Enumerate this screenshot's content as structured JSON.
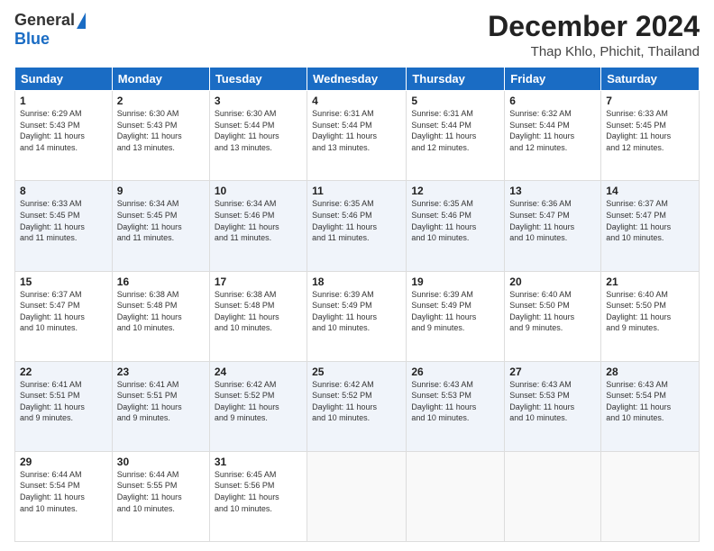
{
  "logo": {
    "general": "General",
    "blue": "Blue"
  },
  "title": {
    "month": "December 2024",
    "location": "Thap Khlo, Phichit, Thailand"
  },
  "weekdays": [
    "Sunday",
    "Monday",
    "Tuesday",
    "Wednesday",
    "Thursday",
    "Friday",
    "Saturday"
  ],
  "weeks": [
    [
      {
        "day": "1",
        "text": "Sunrise: 6:29 AM\nSunset: 5:43 PM\nDaylight: 11 hours\nand 14 minutes."
      },
      {
        "day": "2",
        "text": "Sunrise: 6:30 AM\nSunset: 5:43 PM\nDaylight: 11 hours\nand 13 minutes."
      },
      {
        "day": "3",
        "text": "Sunrise: 6:30 AM\nSunset: 5:44 PM\nDaylight: 11 hours\nand 13 minutes."
      },
      {
        "day": "4",
        "text": "Sunrise: 6:31 AM\nSunset: 5:44 PM\nDaylight: 11 hours\nand 13 minutes."
      },
      {
        "day": "5",
        "text": "Sunrise: 6:31 AM\nSunset: 5:44 PM\nDaylight: 11 hours\nand 12 minutes."
      },
      {
        "day": "6",
        "text": "Sunrise: 6:32 AM\nSunset: 5:44 PM\nDaylight: 11 hours\nand 12 minutes."
      },
      {
        "day": "7",
        "text": "Sunrise: 6:33 AM\nSunset: 5:45 PM\nDaylight: 11 hours\nand 12 minutes."
      }
    ],
    [
      {
        "day": "8",
        "text": "Sunrise: 6:33 AM\nSunset: 5:45 PM\nDaylight: 11 hours\nand 11 minutes."
      },
      {
        "day": "9",
        "text": "Sunrise: 6:34 AM\nSunset: 5:45 PM\nDaylight: 11 hours\nand 11 minutes."
      },
      {
        "day": "10",
        "text": "Sunrise: 6:34 AM\nSunset: 5:46 PM\nDaylight: 11 hours\nand 11 minutes."
      },
      {
        "day": "11",
        "text": "Sunrise: 6:35 AM\nSunset: 5:46 PM\nDaylight: 11 hours\nand 11 minutes."
      },
      {
        "day": "12",
        "text": "Sunrise: 6:35 AM\nSunset: 5:46 PM\nDaylight: 11 hours\nand 10 minutes."
      },
      {
        "day": "13",
        "text": "Sunrise: 6:36 AM\nSunset: 5:47 PM\nDaylight: 11 hours\nand 10 minutes."
      },
      {
        "day": "14",
        "text": "Sunrise: 6:37 AM\nSunset: 5:47 PM\nDaylight: 11 hours\nand 10 minutes."
      }
    ],
    [
      {
        "day": "15",
        "text": "Sunrise: 6:37 AM\nSunset: 5:47 PM\nDaylight: 11 hours\nand 10 minutes."
      },
      {
        "day": "16",
        "text": "Sunrise: 6:38 AM\nSunset: 5:48 PM\nDaylight: 11 hours\nand 10 minutes."
      },
      {
        "day": "17",
        "text": "Sunrise: 6:38 AM\nSunset: 5:48 PM\nDaylight: 11 hours\nand 10 minutes."
      },
      {
        "day": "18",
        "text": "Sunrise: 6:39 AM\nSunset: 5:49 PM\nDaylight: 11 hours\nand 10 minutes."
      },
      {
        "day": "19",
        "text": "Sunrise: 6:39 AM\nSunset: 5:49 PM\nDaylight: 11 hours\nand 9 minutes."
      },
      {
        "day": "20",
        "text": "Sunrise: 6:40 AM\nSunset: 5:50 PM\nDaylight: 11 hours\nand 9 minutes."
      },
      {
        "day": "21",
        "text": "Sunrise: 6:40 AM\nSunset: 5:50 PM\nDaylight: 11 hours\nand 9 minutes."
      }
    ],
    [
      {
        "day": "22",
        "text": "Sunrise: 6:41 AM\nSunset: 5:51 PM\nDaylight: 11 hours\nand 9 minutes."
      },
      {
        "day": "23",
        "text": "Sunrise: 6:41 AM\nSunset: 5:51 PM\nDaylight: 11 hours\nand 9 minutes."
      },
      {
        "day": "24",
        "text": "Sunrise: 6:42 AM\nSunset: 5:52 PM\nDaylight: 11 hours\nand 9 minutes."
      },
      {
        "day": "25",
        "text": "Sunrise: 6:42 AM\nSunset: 5:52 PM\nDaylight: 11 hours\nand 10 minutes."
      },
      {
        "day": "26",
        "text": "Sunrise: 6:43 AM\nSunset: 5:53 PM\nDaylight: 11 hours\nand 10 minutes."
      },
      {
        "day": "27",
        "text": "Sunrise: 6:43 AM\nSunset: 5:53 PM\nDaylight: 11 hours\nand 10 minutes."
      },
      {
        "day": "28",
        "text": "Sunrise: 6:43 AM\nSunset: 5:54 PM\nDaylight: 11 hours\nand 10 minutes."
      }
    ],
    [
      {
        "day": "29",
        "text": "Sunrise: 6:44 AM\nSunset: 5:54 PM\nDaylight: 11 hours\nand 10 minutes."
      },
      {
        "day": "30",
        "text": "Sunrise: 6:44 AM\nSunset: 5:55 PM\nDaylight: 11 hours\nand 10 minutes."
      },
      {
        "day": "31",
        "text": "Sunrise: 6:45 AM\nSunset: 5:56 PM\nDaylight: 11 hours\nand 10 minutes."
      },
      {
        "day": "",
        "text": ""
      },
      {
        "day": "",
        "text": ""
      },
      {
        "day": "",
        "text": ""
      },
      {
        "day": "",
        "text": ""
      }
    ]
  ]
}
